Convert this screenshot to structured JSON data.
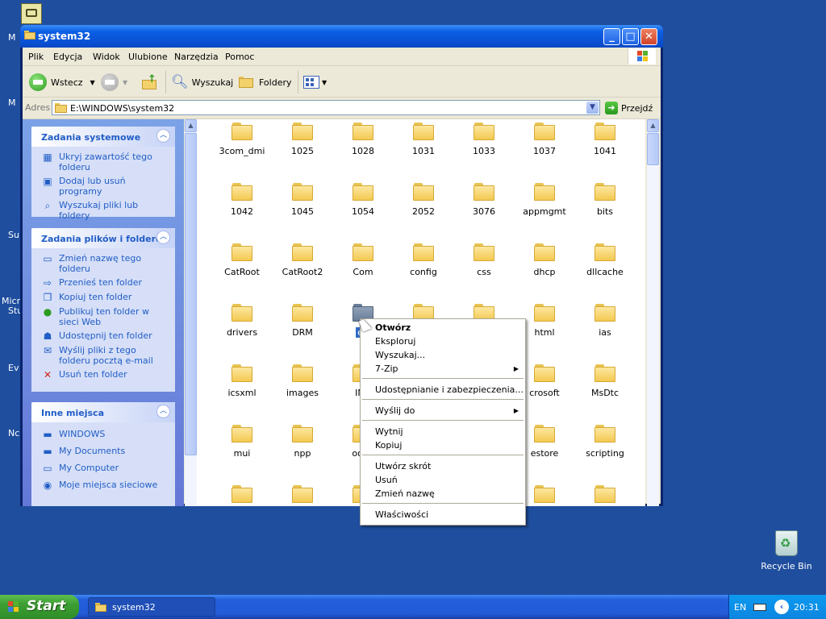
{
  "desktop": {
    "fragments": [
      "M",
      "M",
      "Su",
      "Micro",
      "Stu",
      "Ev",
      "Nc"
    ],
    "recycle_bin_label": "Recycle Bin"
  },
  "window": {
    "title": "system32",
    "menu": [
      "Plik",
      "Edycja",
      "Widok",
      "Ulubione",
      "Narzędzia",
      "Pomoc"
    ],
    "toolbar": {
      "back": "Wstecz",
      "search": "Wyszukaj",
      "folders": "Foldery"
    },
    "address": {
      "label": "Adres",
      "value": "E:\\WINDOWS\\system32",
      "go": "Przejdź"
    }
  },
  "left_pane": {
    "system_tasks": {
      "title": "Zadania systemowe",
      "items": [
        "Ukryj zawartość tego folderu",
        "Dodaj lub usuń programy",
        "Wyszukaj pliki lub foldery"
      ]
    },
    "file_tasks": {
      "title": "Zadania plików i folderów",
      "items": [
        "Zmień nazwę tego folderu",
        "Przenieś ten folder",
        "Kopiuj ten folder",
        "Publikuj ten folder w sieci Web",
        "Udostępnij ten folder",
        "Wyślij pliki z tego folderu pocztą e-mail",
        "Usuń ten folder"
      ]
    },
    "other_places": {
      "title": "Inne miejsca",
      "items": [
        "WINDOWS",
        "My Documents",
        "My Computer",
        "Moje miejsca sieciowe"
      ]
    }
  },
  "folders": [
    "3com_dmi",
    "1025",
    "1028",
    "1031",
    "1033",
    "1037",
    "1041",
    "1042",
    "1045",
    "1054",
    "2052",
    "3076",
    "appmgmt",
    "bits",
    "CatRoot",
    "CatRoot2",
    "Com",
    "config",
    "css",
    "dhcp",
    "dllcache",
    "drivers",
    "DRM",
    "en",
    "",
    "",
    "html",
    "ias",
    "icsxml",
    "images",
    "IME",
    "",
    "",
    "crosoft",
    "MsDtc",
    "mui",
    "npp",
    "oobe",
    "",
    "",
    "estore",
    "scripting"
  ],
  "selected_folder": "en",
  "context_menu": {
    "open": "Otwórz",
    "explore": "Eksploruj",
    "search": "Wyszukaj...",
    "zip": "7-Zip",
    "sharing": "Udostępnianie i zabezpieczenia...",
    "send_to": "Wyślij do",
    "cut": "Wytnij",
    "copy": "Kopiuj",
    "shortcut": "Utwórz skrót",
    "delete": "Usuń",
    "rename": "Zmień nazwę",
    "properties": "Właściwości"
  },
  "taskbar": {
    "start": "Start",
    "task": "system32",
    "lang": "EN",
    "clock": "20:31"
  }
}
